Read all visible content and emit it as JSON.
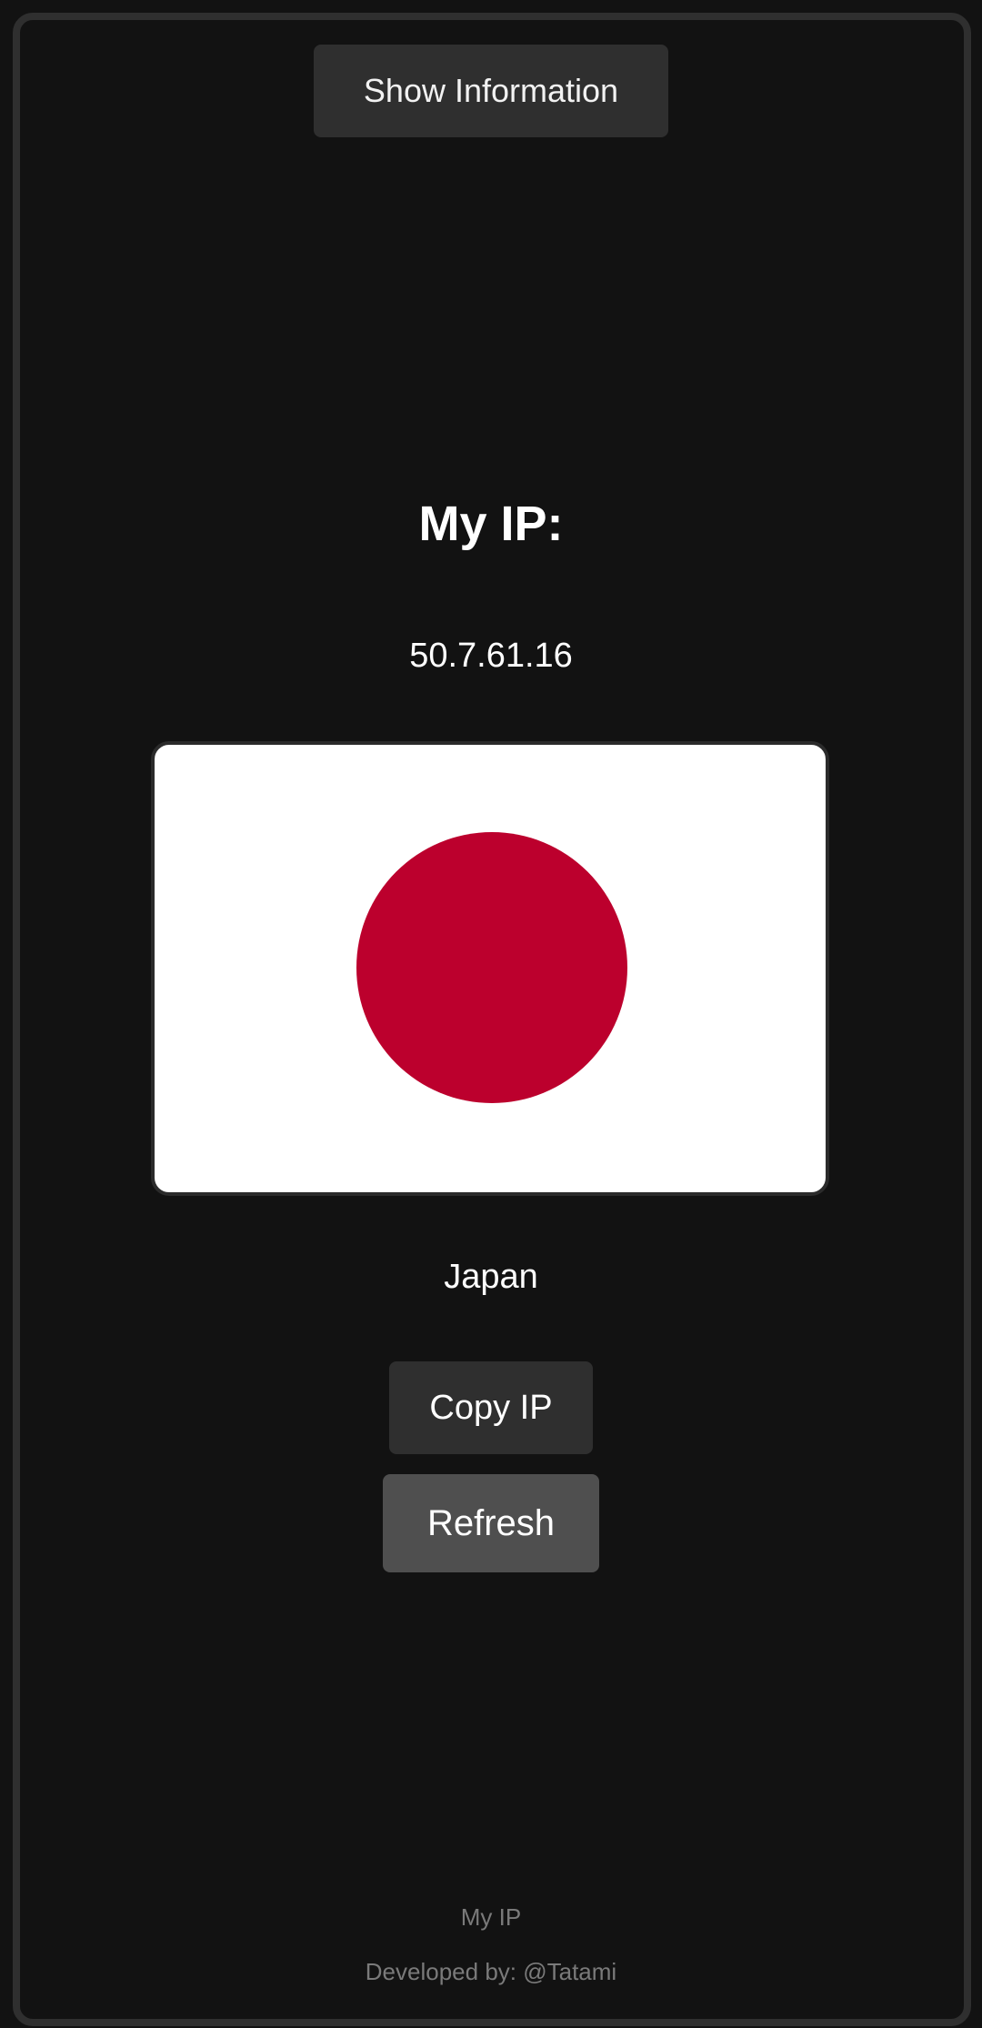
{
  "header": {
    "show_information_label": "Show Information"
  },
  "main": {
    "title": "My IP:",
    "ip_address": "50.7.61.16",
    "country": "Japan",
    "flag": {
      "icon": "japan-flag",
      "background_color": "#ffffff",
      "disc_color": "#bc002d"
    },
    "copy_label": "Copy IP",
    "refresh_label": "Refresh"
  },
  "footer": {
    "app_name": "My IP",
    "developer": "Developed by: @Tatami"
  }
}
